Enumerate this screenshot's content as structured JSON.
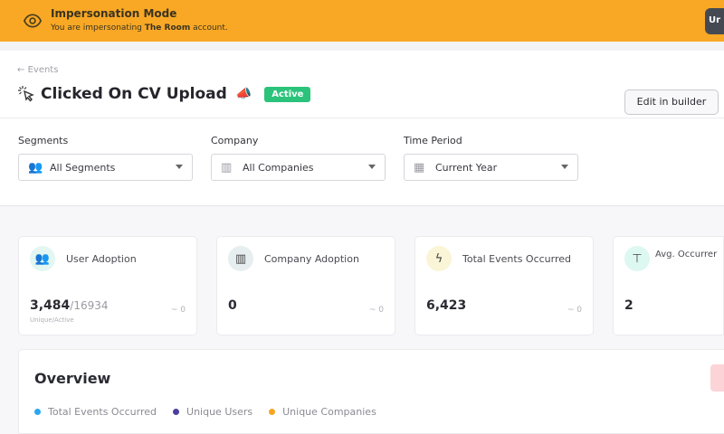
{
  "banner": {
    "title": "Impersonation Mode",
    "text_prefix": "You are impersonating ",
    "account": "The Room",
    "text_suffix": " account.",
    "button_label": "Ur",
    "color": "#f9a825"
  },
  "header": {
    "back_label": "Events",
    "title": "Clicked On CV Upload",
    "status": "Active",
    "status_color": "#2bc37b",
    "edit_button": "Edit in builder"
  },
  "filters": [
    {
      "label": "Segments",
      "value": "All Segments",
      "icon": "users-icon"
    },
    {
      "label": "Company",
      "value": "All Companies",
      "icon": "building-icon"
    },
    {
      "label": "Time Period",
      "value": "Current Year",
      "icon": "calendar-icon"
    }
  ],
  "cards": [
    {
      "title": "User Adoption",
      "value": "3,484",
      "total": "/16934",
      "sub": "Unique/Active",
      "trend": "0",
      "icon": "users-icon",
      "icon_bg": "#e3f6f2"
    },
    {
      "title": "Company Adoption",
      "value": "0",
      "trend": "0",
      "icon": "building-icon",
      "icon_bg": "#e6eef0"
    },
    {
      "title": "Total Events Occurred",
      "value": "6,423",
      "trend": "0",
      "icon": "lightning-icon",
      "icon_bg": "#faf5d6"
    },
    {
      "title": "Avg. Occurrer",
      "value": "2",
      "icon": "average-icon",
      "icon_bg": "#ddf7f1"
    }
  ],
  "overview": {
    "title": "Overview",
    "legend": [
      {
        "label": "Total Events Occurred",
        "color": "#29a8f0"
      },
      {
        "label": "Unique Users",
        "color": "#4b3f9e"
      },
      {
        "label": "Unique Companies",
        "color": "#f5a623"
      }
    ]
  }
}
